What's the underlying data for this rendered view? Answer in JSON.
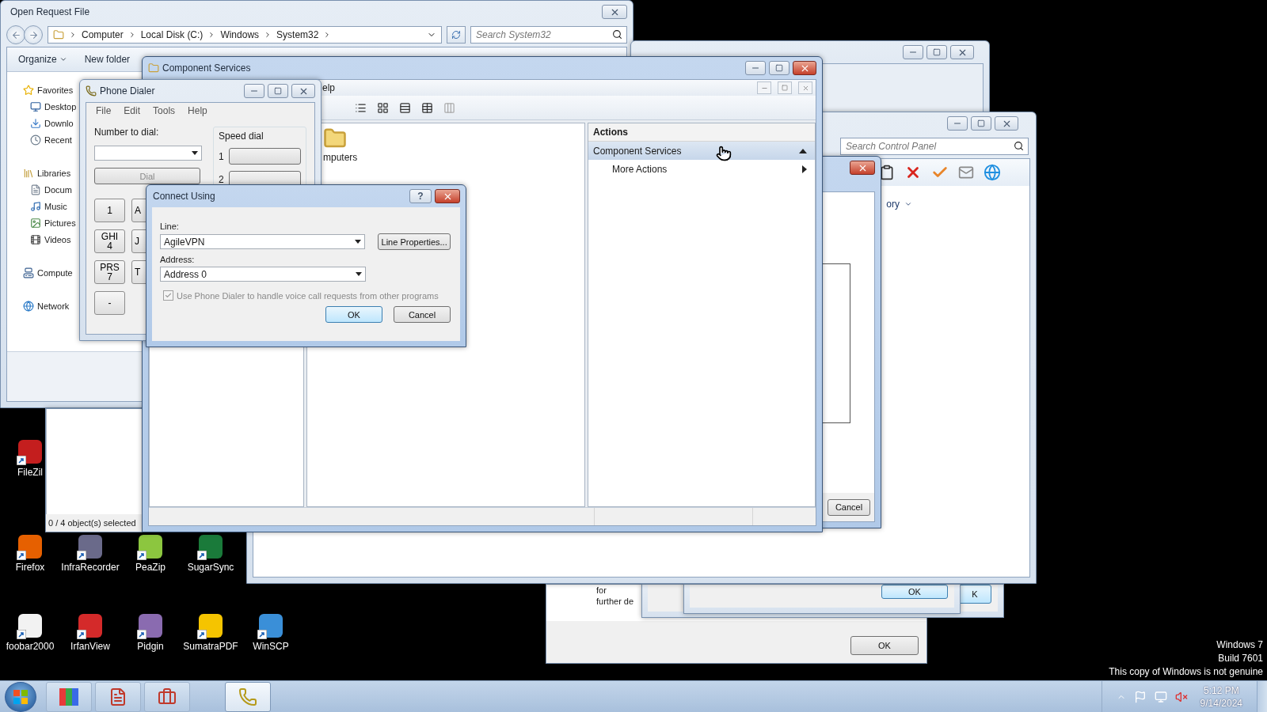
{
  "explorer": {
    "title": "Open Request File",
    "active": false,
    "breadcrumb": [
      "Computer",
      "Local Disk (C:)",
      "Windows",
      "System32"
    ],
    "search": {
      "placeholder": "Search System32"
    },
    "toolbar": [
      {
        "label": "Organize",
        "kind": "menu"
      },
      {
        "label": "New folder",
        "kind": "button"
      }
    ],
    "nav": [
      {
        "label": "Favorites",
        "kind": "group"
      },
      {
        "label": "Desktop",
        "kind": "item"
      },
      {
        "label": "Downlo",
        "kind": "item"
      },
      {
        "label": "Recent",
        "kind": "item"
      },
      {
        "label": "Libraries",
        "kind": "group"
      },
      {
        "label": "Docum",
        "kind": "item"
      },
      {
        "label": "Music",
        "kind": "item"
      },
      {
        "label": "Pictures",
        "kind": "item"
      },
      {
        "label": "Videos",
        "kind": "item"
      },
      {
        "label": "Compute",
        "kind": "group"
      },
      {
        "label": "Network",
        "kind": "group"
      }
    ]
  },
  "file_list_window": {
    "status": "0 / 4 object(s) selected"
  },
  "control_panel": {
    "search": {
      "placeholder": "Search Control Panel"
    },
    "view_link": "ory"
  },
  "control_panel_dialog": {
    "active": true,
    "button": "Cancel"
  },
  "message_dialogs": [
    {
      "lines": [
        "for",
        "further de"
      ],
      "button": "OK"
    },
    {
      "button": "OK"
    },
    {
      "button": "K"
    }
  ],
  "component_services": {
    "title": "Component Services",
    "active": true,
    "menu": [
      "elp"
    ],
    "items": [
      "mputers"
    ],
    "actions": {
      "header": "Actions",
      "items": [
        {
          "label": "Component Services",
          "kind": "section",
          "selected": true
        },
        {
          "label": "More Actions",
          "kind": "submenu",
          "selected": false
        }
      ]
    }
  },
  "phone_dialer": {
    "title": "Phone Dialer",
    "active": false,
    "menu": [
      "File",
      "Edit",
      "Tools",
      "Help"
    ],
    "number_label": "Number to dial:",
    "dial_button": {
      "label": "Dial",
      "disabled": true
    },
    "speed_dial": {
      "label": "Speed dial",
      "entries": [
        "1",
        "2"
      ]
    },
    "keypad": [
      {
        "digit": "1"
      },
      {
        "letters": "A"
      },
      {
        "letters": "GHI",
        "digit": "4"
      },
      {
        "letters": "J"
      },
      {
        "letters": "PRS",
        "digit": "7"
      },
      {
        "letters": "T"
      },
      {
        "digit": "-"
      }
    ]
  },
  "connect_using": {
    "title": "Connect Using",
    "active": true,
    "help_button": "?",
    "fields": [
      {
        "label": "Line:",
        "value": "AgileVPN"
      },
      {
        "label": "Address:",
        "value": "Address 0"
      }
    ],
    "line_properties": "Line Properties...",
    "option": {
      "label": "Use Phone Dialer to handle voice call requests from other programs",
      "checked": true,
      "disabled": true
    },
    "buttons": [
      {
        "label": "OK",
        "default": true
      },
      {
        "label": "Cancel",
        "default": false
      }
    ]
  },
  "desktop_icons": [
    [
      {
        "label": "FileZil",
        "color": "#c41e1e"
      }
    ],
    [
      {
        "label": "Firefox",
        "color": "#e66000"
      },
      {
        "label": "InfraRecorder",
        "color": "#6a6a8a"
      },
      {
        "label": "PeaZip",
        "color": "#8cc63f"
      },
      {
        "label": "SugarSync",
        "color": "#1a7a3a"
      }
    ],
    [
      {
        "label": "foobar2000",
        "color": "#f2f2f2"
      },
      {
        "label": "IrfanView",
        "color": "#d42a2a"
      },
      {
        "label": "Pidgin",
        "color": "#8a6bb0"
      },
      {
        "label": "SumatraPDF",
        "color": "#f5c400"
      },
      {
        "label": "WinSCP",
        "color": "#3a8fd8"
      }
    ]
  ],
  "os_notice": [
    "Windows 7",
    "Build 7601",
    "This copy of Windows is not genuine"
  ],
  "taskbar": {
    "buttons": [
      {
        "selected": false
      },
      {
        "selected": false
      },
      {
        "selected": false
      },
      {
        "selected": true
      }
    ],
    "clock": {
      "time": "5:12 PM",
      "date": "9/14/2024"
    }
  }
}
